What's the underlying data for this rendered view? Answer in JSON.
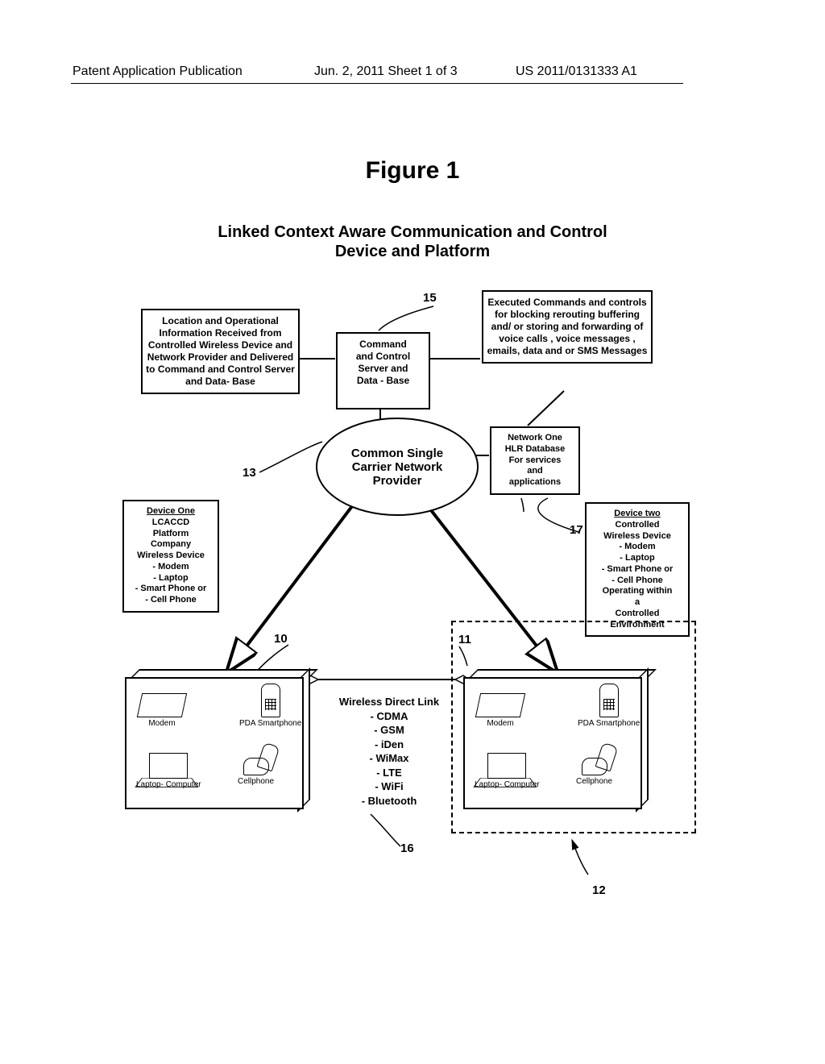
{
  "header": {
    "left": "Patent Application Publication",
    "center": "Jun. 2, 2011   Sheet 1 of 3",
    "right": "US 2011/0131333 A1"
  },
  "figure": {
    "title": "Figure 1",
    "subtitle_l1": "Linked Context Aware Communication and Control",
    "subtitle_l2": "Device and Platform"
  },
  "boxes": {
    "info": "Location and Operational Information Received from Controlled Wireless Device and Network Provider and Delivered to Command and Control Server and Data- Base",
    "ccs_l1": "Command",
    "ccs_l2": "and Control",
    "ccs_l3": "Server and",
    "ccs_l4": "Data - Base",
    "exec": "Executed Commands and controls for blocking rerouting  buffering  and/ or storing and forwarding of voice calls ,  voice messages , emails, data and or SMS Messages",
    "ellipse_l1": "Common Single",
    "ellipse_l2": "Carrier Network",
    "ellipse_l3": "Provider",
    "hlr_l1": "Network One",
    "hlr_l2": "HLR Database",
    "hlr_l3": "For services",
    "hlr_l4": "and",
    "hlr_l5": "applications",
    "dev1_title": "Device One",
    "dev1_l1": "LCACCD",
    "dev1_l2": "Platform",
    "dev1_l3": "Company",
    "dev1_l4": "Wireless Device",
    "dev1_l5": "- Modem",
    "dev1_l6": "- Laptop",
    "dev1_l7": "- Smart Phone or",
    "dev1_l8": "- Cell Phone",
    "dev2_title": "Device two",
    "dev2_l1": "Controlled",
    "dev2_l2": "Wireless Device",
    "dev2_l3": "- Modem",
    "dev2_l4": "- Laptop",
    "dev2_l5": "- Smart Phone or",
    "dev2_l6": "- Cell Phone",
    "dev2_l7": "Operating within",
    "dev2_l8": "a",
    "dev2_l9": "Controlled",
    "dev2_l10": "Environment"
  },
  "labels": {
    "n10": "10",
    "n11": "11",
    "n12": "12",
    "n13": "13",
    "n15": "15",
    "n16": "16",
    "n17": "17"
  },
  "devices": {
    "modem": "Modem",
    "pda": "PDA Smartphone",
    "laptop": "Laptop-  Computer",
    "cell": "Cellphone"
  },
  "link": {
    "title": "Wireless Direct Link",
    "i1": "- CDMA",
    "i2": "- GSM",
    "i3": "- iDen",
    "i4": "- WiMax",
    "i5": "- LTE",
    "i6": "- WiFi",
    "i7": "- Bluetooth"
  }
}
